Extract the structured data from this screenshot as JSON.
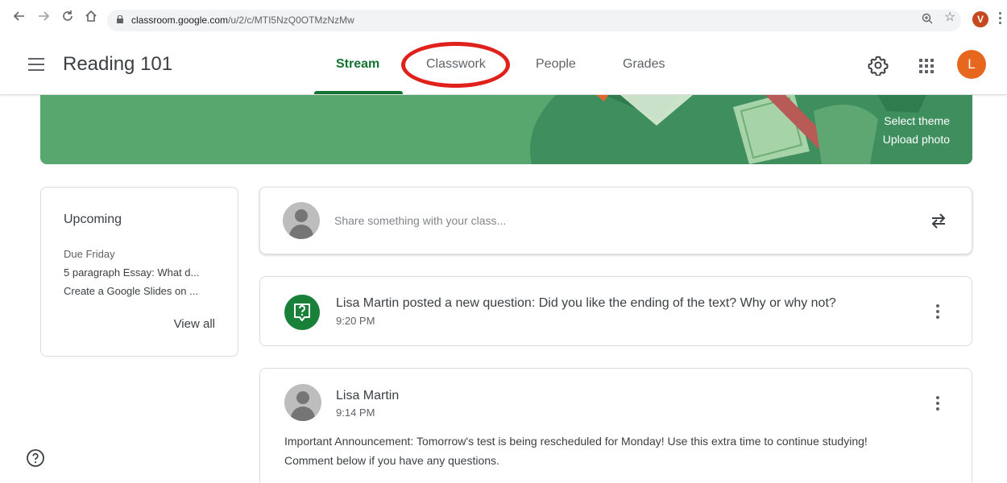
{
  "browser": {
    "url_host": "classroom.google.com",
    "url_path": "/u/2/c/MTI5NzQ0OTMzNzMw",
    "profile_initial": "V"
  },
  "header": {
    "class_title": "Reading 101",
    "tabs": [
      {
        "label": "Stream",
        "active": true
      },
      {
        "label": "Classwork",
        "active": false,
        "highlighted": true
      },
      {
        "label": "People",
        "active": false
      },
      {
        "label": "Grades",
        "active": false
      }
    ],
    "account_initial": "L"
  },
  "banner": {
    "select_theme": "Select theme",
    "upload_photo": "Upload photo"
  },
  "upcoming": {
    "title": "Upcoming",
    "due_label": "Due Friday",
    "items": [
      "5 paragraph Essay: What d...",
      "Create a Google Slides on ..."
    ],
    "view_all": "View all"
  },
  "share": {
    "placeholder": "Share something with your class..."
  },
  "posts": [
    {
      "title": "Lisa Martin posted a new question: Did you like the ending of the text? Why or why not?",
      "time": "9:20 PM"
    },
    {
      "author": "Lisa Martin",
      "time": "9:14 PM",
      "body_line1": "Important Announcement: Tomorrow's test is being rescheduled for Monday! Use this extra time to continue studying!",
      "body_line2": "Comment below if you have any questions."
    }
  ],
  "colors": {
    "accent_green": "#137333",
    "banner_green": "#57a76f",
    "highlight_red": "#e0201b",
    "avatar_orange": "#e8671e"
  }
}
